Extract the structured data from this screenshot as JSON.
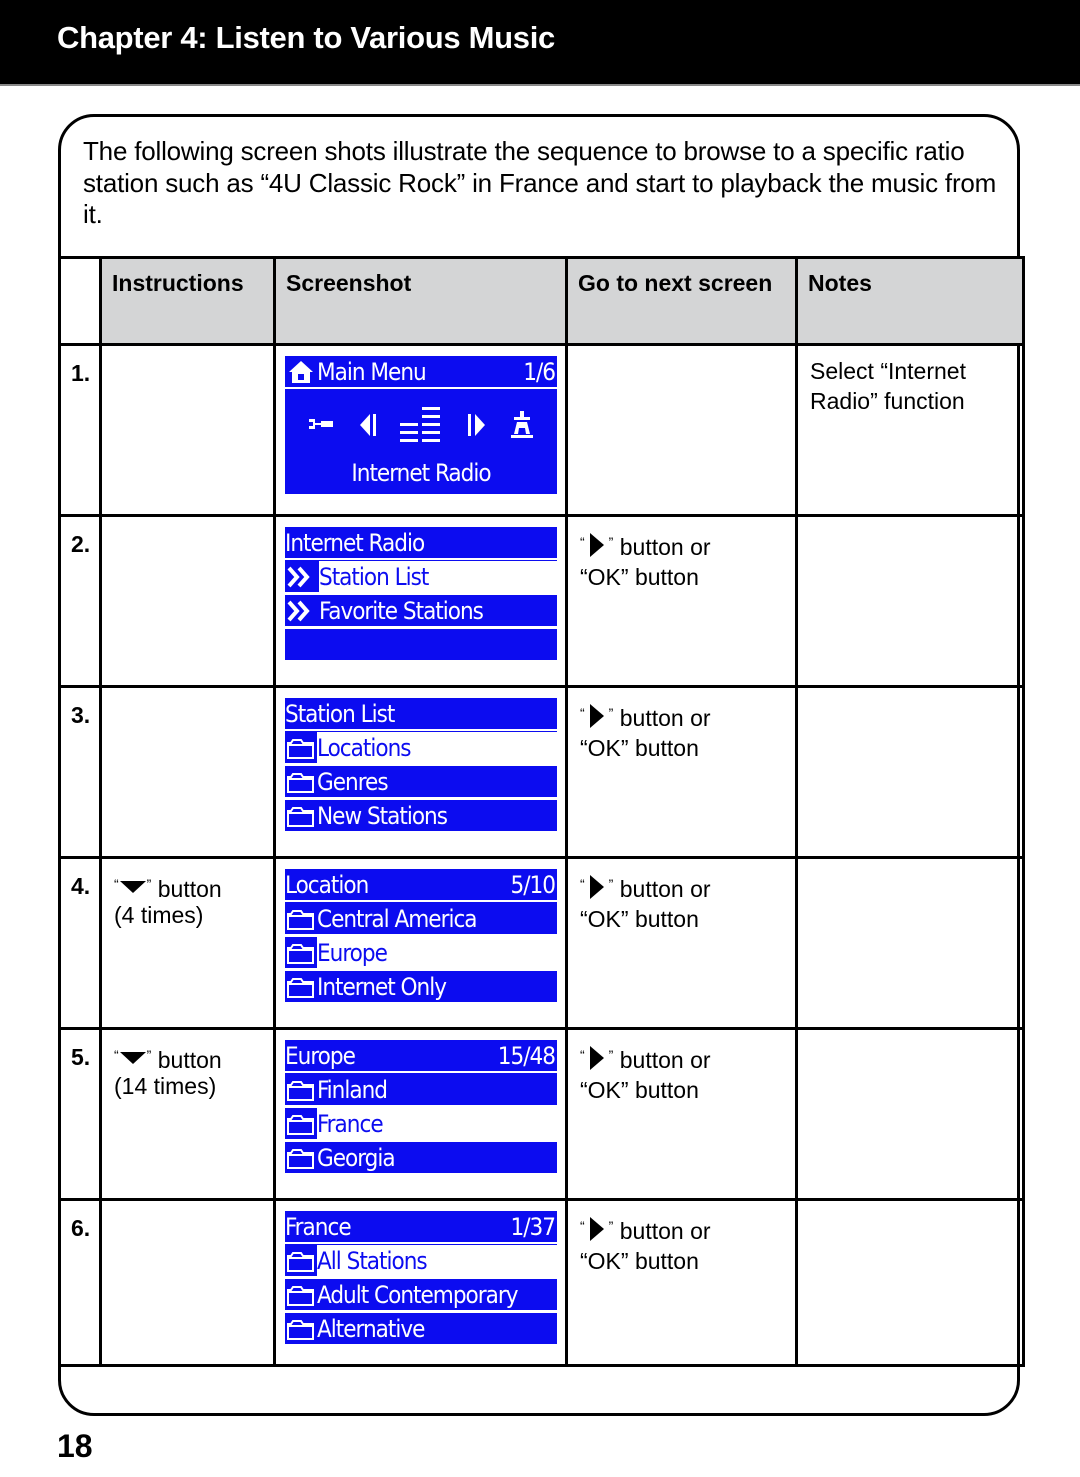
{
  "header": {
    "title": "Chapter 4: Listen to Various Music"
  },
  "intro": "The following screen shots illustrate the sequence to browse to a specific ratio station such as “4U Classic Rock” in France and start to playback the music from it.",
  "table": {
    "columns": [
      "",
      "Instructions",
      "Screenshot",
      "Go to next screen",
      "Notes"
    ],
    "rows": [
      {
        "num": "1.",
        "instruction": null,
        "next": null,
        "notes": "Select “Internet Radio” function",
        "screen": {
          "type": "main-menu",
          "title": "Main Menu",
          "count": "1/6",
          "icons": [
            "wrench-icon",
            "prev-icon",
            "equalizer-icon",
            "next-icon",
            "tower-icon"
          ],
          "label": "Internet Radio"
        }
      },
      {
        "num": "2.",
        "instruction": null,
        "next": {
          "key": "right-arrow",
          "text1": "button or",
          "text2": "“OK” button"
        },
        "notes": "",
        "screen": {
          "type": "list",
          "title": "Internet Radio",
          "count": "",
          "item_icon": "double-chevron-icon",
          "items": [
            {
              "label": "Station List",
              "selected": true
            },
            {
              "label": "Favorite Stations",
              "selected": false
            },
            {
              "label": "",
              "selected": false
            }
          ]
        }
      },
      {
        "num": "3.",
        "instruction": null,
        "next": {
          "key": "right-arrow",
          "text1": "button or",
          "text2": "“OK” button"
        },
        "notes": "",
        "screen": {
          "type": "list",
          "title": "Station List",
          "count": "",
          "item_icon": "folder-icon",
          "items": [
            {
              "label": "Locations",
              "selected": true
            },
            {
              "label": "Genres",
              "selected": false
            },
            {
              "label": "New Stations",
              "selected": false
            }
          ]
        }
      },
      {
        "num": "4.",
        "instruction": {
          "key": "down-arrow",
          "text": "button",
          "times": "(4 times)"
        },
        "next": {
          "key": "right-arrow",
          "text1": "button or",
          "text2": "“OK” button"
        },
        "notes": "",
        "screen": {
          "type": "list",
          "title": "Location",
          "count": "5/10",
          "item_icon": "folder-icon",
          "items": [
            {
              "label": "Central America",
              "selected": false
            },
            {
              "label": "Europe",
              "selected": true
            },
            {
              "label": "Internet Only",
              "selected": false
            }
          ]
        }
      },
      {
        "num": "5.",
        "instruction": {
          "key": "down-arrow",
          "text": "button",
          "times": "(14 times)"
        },
        "next": {
          "key": "right-arrow",
          "text1": "button or",
          "text2": "“OK” button"
        },
        "notes": "",
        "screen": {
          "type": "list",
          "title": "Europe",
          "count": "15/48",
          "item_icon": "folder-icon",
          "items": [
            {
              "label": "Finland",
              "selected": false
            },
            {
              "label": "France",
              "selected": true
            },
            {
              "label": "Georgia",
              "selected": false
            }
          ]
        }
      },
      {
        "num": "6.",
        "instruction": null,
        "next": {
          "key": "right-arrow",
          "text1": "button or",
          "text2": "“OK” button"
        },
        "notes": "",
        "screen": {
          "type": "list",
          "title": "France",
          "count": "1/37",
          "item_icon": "folder-icon",
          "items": [
            {
              "label": "All Stations",
              "selected": true
            },
            {
              "label": "Adult Contemporary",
              "selected": false
            },
            {
              "label": "Alternative",
              "selected": false
            }
          ]
        }
      }
    ]
  },
  "colors": {
    "lcd_blue": "#0c0cf0",
    "header_bg": "#d4d5d6"
  },
  "page_number": "18"
}
